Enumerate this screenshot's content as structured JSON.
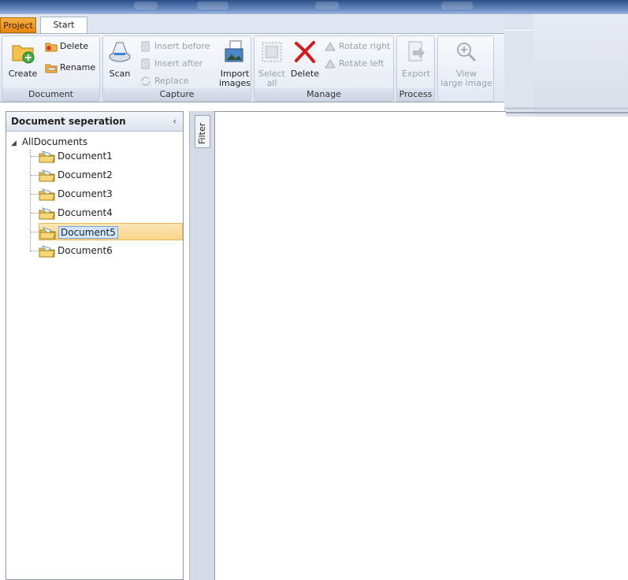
{
  "tabs": {
    "project": "Project",
    "start": "Start"
  },
  "ribbon": {
    "document": {
      "label": "Document",
      "create": "Create",
      "delete": "Delete",
      "rename": "Rename"
    },
    "capture": {
      "label": "Capture",
      "scan": "Scan",
      "insert_before": "Insert before",
      "insert_after": "Insert after",
      "replace": "Replace",
      "import_images_line1": "Import",
      "import_images_line2": "images"
    },
    "manage": {
      "label": "Manage",
      "select_all_line1": "Select",
      "select_all_line2": "all",
      "delete": "Delete",
      "rotate_right": "Rotate right",
      "rotate_left": "Rotate left"
    },
    "process": {
      "label": "Process",
      "export": "Export"
    },
    "view": {
      "view_large_line1": "View",
      "view_large_line2": "large image"
    }
  },
  "left_pane": {
    "title": "Document seperation",
    "collapse_glyph": "‹",
    "root": "AllDocuments",
    "documents": [
      "Document1",
      "Document2",
      "Document3",
      "Document4",
      "Document5",
      "Document6"
    ],
    "selected": "Document5"
  },
  "filter": {
    "label": "Filter"
  },
  "colors": {
    "project_tab": "#f0a030",
    "selection": "#fbd38a",
    "accent_blue": "#2a4d86"
  }
}
